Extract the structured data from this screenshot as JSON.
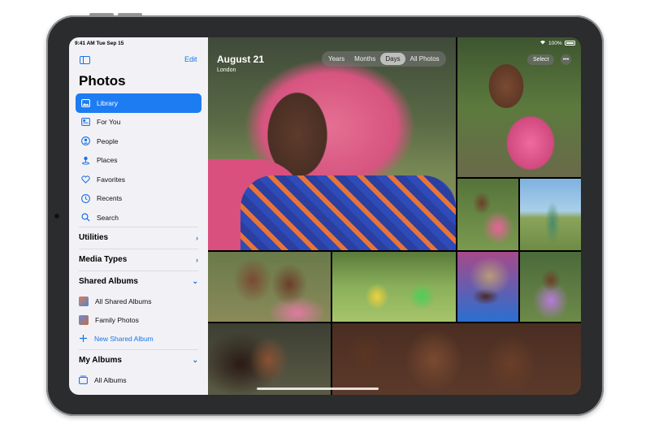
{
  "status_bar": {
    "time": "9:41 AM  Tue Sep 15",
    "battery": "100%"
  },
  "sidebar": {
    "edit_label": "Edit",
    "title": "Photos",
    "items": [
      {
        "label": "Library",
        "icon": "library-icon",
        "active": true
      },
      {
        "label": "For You",
        "icon": "for-you-icon"
      },
      {
        "label": "People",
        "icon": "people-icon"
      },
      {
        "label": "Places",
        "icon": "places-icon"
      },
      {
        "label": "Favorites",
        "icon": "heart-icon"
      },
      {
        "label": "Recents",
        "icon": "clock-icon"
      },
      {
        "label": "Search",
        "icon": "search-icon"
      }
    ],
    "sections": {
      "utilities": "Utilities",
      "media_types": "Media Types",
      "shared_albums": "Shared Albums",
      "my_albums": "My Albums"
    },
    "shared_items": {
      "all_shared": "All Shared Albums",
      "family": "Family Photos",
      "new_shared": "New Shared Album"
    },
    "my_album_items": {
      "all_albums": "All Albums"
    }
  },
  "main": {
    "date_title": "August 21",
    "location": "London",
    "view_tabs": [
      "Years",
      "Months",
      "Days",
      "All Photos"
    ],
    "active_tab": "Days",
    "select_label": "Select",
    "more_label": "•••"
  },
  "colors": {
    "accent": "#1e7cf2",
    "sidebar_bg": "#f2f2f6"
  }
}
